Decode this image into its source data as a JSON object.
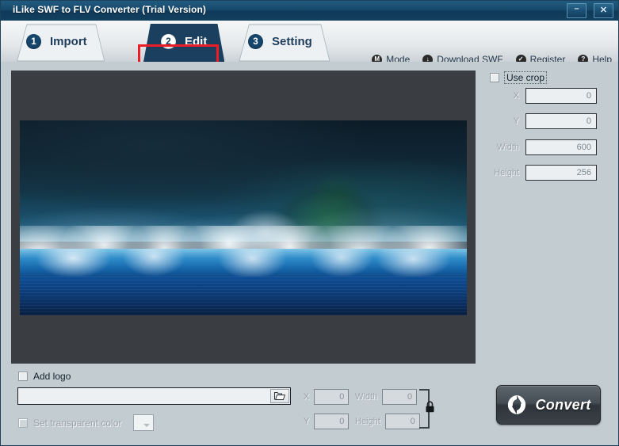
{
  "window": {
    "title": "iLike SWF to FLV Converter (Trial Version)",
    "minimize_label": "Minimize",
    "close_label": "Close"
  },
  "tabs": [
    {
      "number": "1",
      "label": "Import",
      "active": false
    },
    {
      "number": "2",
      "label": "Edit",
      "active": true
    },
    {
      "number": "3",
      "label": "Setting",
      "active": false
    }
  ],
  "toolbar_menu": [
    {
      "icon": "mode-icon",
      "glyph": "M",
      "label": "Mode"
    },
    {
      "icon": "download-icon",
      "glyph": "↓",
      "label": "Download SWF"
    },
    {
      "icon": "register-icon",
      "glyph": "✓",
      "label": "Register"
    },
    {
      "icon": "help-icon",
      "glyph": "?",
      "label": "Help"
    }
  ],
  "crop_panel": {
    "use_crop_label": "Use crop",
    "use_crop_checked": false,
    "fields": [
      {
        "label": "X",
        "value": "0"
      },
      {
        "label": "Y",
        "value": "0"
      },
      {
        "label": "Width",
        "value": "600"
      },
      {
        "label": "Height",
        "value": "256"
      }
    ]
  },
  "logo_panel": {
    "add_logo_label": "Add logo",
    "add_logo_checked": false,
    "logo_path_value": "",
    "logo_path_placeholder": "",
    "browse_icon": "open-folder-icon",
    "transparent_label": "Set transparent color",
    "transparent_checked": false,
    "color_swatch": "#ffffff",
    "fields": [
      {
        "label": "X",
        "value": "0"
      },
      {
        "label": "Y",
        "value": "0"
      },
      {
        "label": "Width",
        "value": "0"
      },
      {
        "label": "Height",
        "value": "0"
      }
    ],
    "lock_icon": "aspect-ratio-lock-icon"
  },
  "convert": {
    "label": "Convert",
    "icon": "convert-refresh-icon"
  },
  "preview": {
    "alt": "SWF preview frame: crashing ocean waves with white foam under a dark stormy sky"
  },
  "colors": {
    "titlebar": "#174a6c",
    "panel": "#c3ccd1",
    "tab_active": "#1b3f5e",
    "highlight_red": "#ee1c24",
    "canvas": "#3a3d42"
  }
}
